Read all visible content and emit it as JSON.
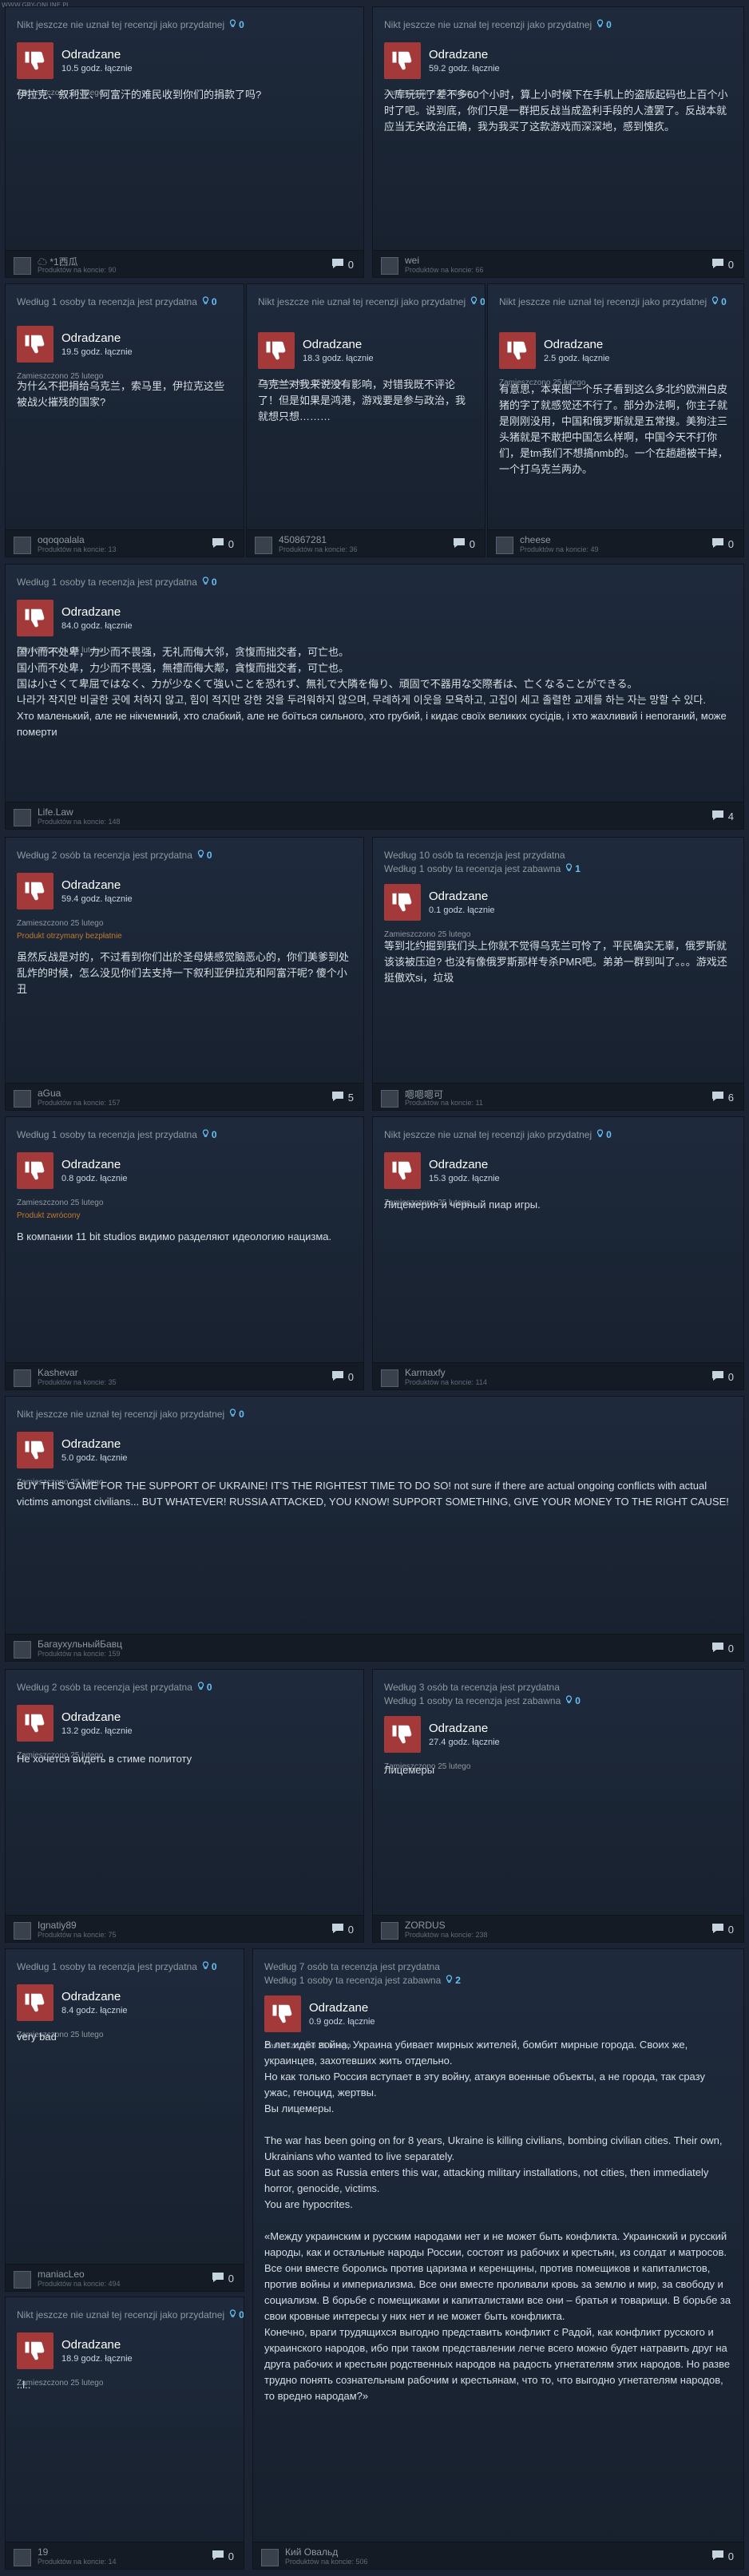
{
  "watermark": "WWW.GRY-ONLINE.PL",
  "theme": {
    "thumb_bg": "#a33939",
    "bulb": "#66c0f4",
    "note_orange": "#c47a2c"
  },
  "icons": {
    "thumb": "thumbs-down-icon",
    "bulb": "lightbulb-icon",
    "comment": "comment-icon"
  },
  "reviews": [
    {
      "h1": "Nikt jeszcze nie uznał tej recenzji jako przydatnej",
      "h1c": "0",
      "h2": "",
      "h2c": "",
      "verdict": "Odradzane",
      "hours": "10.5 godz. łącznie",
      "posted": "Zamieszczono 25 lutego",
      "note": "",
      "body": "伊拉克、叙利亚、阿富汗的难民收到你们的捐款了吗?",
      "user": "☁ *1西瓜",
      "upost": "Produktów na koncie: 90",
      "comments": "0"
    },
    {
      "h1": "Nikt jeszcze nie uznał tej recenzji jako przydatnej",
      "h1c": "0",
      "h2": "",
      "h2c": "",
      "verdict": "Odradzane",
      "hours": "59.2 godz. łącznie",
      "posted": "Zamieszczono 25 lutego",
      "note": "",
      "body": "入库玩玩了差不多60个小时，算上小时候下在手机上的盗版起码也上百个小时了吧。说到底，你们只是一群把反战当成盈利手段的人渣罢了。反战本就应当无关政治正确，我为我买了这款游戏而深深地，感到愧疚。",
      "user": "wei",
      "upost": "Produktów na koncie: 66",
      "comments": "0"
    },
    {
      "h1": "Według 1 osoby ta recenzja jest przydatna",
      "h1c": "0",
      "h2": "",
      "h2c": "",
      "verdict": "Odradzane",
      "hours": "19.5 godz. łącznie",
      "posted": "Zamieszczono 25 lutego",
      "note": "",
      "body": "为什么不把捐给乌克兰，索马里，伊拉克这些被战火摧残的国家?",
      "user": "oqoqoalala",
      "upost": "Produktów na koncie: 13",
      "comments": "0"
    },
    {
      "h1": "Nikt jeszcze nie uznał tej recenzji jako przydatnej",
      "h1c": "0",
      "h2": "",
      "h2c": "",
      "verdict": "Odradzane",
      "hours": "18.3 godz. łącznie",
      "posted": "Zamieszczono 25 lutego",
      "note": "",
      "body": "乌克兰对我来说没有影响，对错我既不评论了！但是如果是鸿港，游戏要是参与政治，我就想只想………",
      "user": "450867281",
      "upost": "Produktów na koncie: 36",
      "comments": "0"
    },
    {
      "h1": "Nikt jeszcze nie uznał tej recenzji jako przydatnej",
      "h1c": "0",
      "h2": "",
      "h2c": "",
      "verdict": "Odradzane",
      "hours": "2.5 godz. łącznie",
      "posted": "Zamieszczono 25 lutego",
      "note": "",
      "body": "有意思，本来图一个乐子看到这么多北约欧洲白皮猪的字了就感觉还不行了。部分办法啊，你主子就是刚刚没用，中国和俄罗斯就是五常搜。美狗注三头猪就是不敢把中国怎么样啊，中国今天不打你们，是tm我们不想搞nmb的。一个在趟趟被干掉，一个打乌克兰两办。",
      "user": "cheese",
      "upost": "Produktów na koncie: 49",
      "comments": "0"
    },
    {
      "h1": "Według 1 osoby ta recenzja jest przydatna",
      "h1c": "0",
      "h2": "",
      "h2c": "",
      "verdict": "Odradzane",
      "hours": "84.0 godz. łącznie",
      "posted": "Zamieszczono 25 lutego",
      "note": "",
      "body": "国小而不处卑，力少而不畏强，无礼而侮大邻，贪愎而拙交者，可亡也。\n国小而不处卑，力少而不畏强，無禮而侮大鄰，貪愎而拙交者，可亡也。\n国は小さくて卑屈ではなく、力が少なくて強いことを恐れず、無礼で大隣を侮り、頑固で不器用な交際者は、亡くなることができる。\n나라가 작지만 비굴한 곳에 처하지 않고, 힘이 적지만 강한 것을 두려워하지 않으며, 무례하게 이웃을 모욕하고, 고집이 세고 졸렬한 교제를 하는 자는 망할 수 있다.\nХто маленький, але не нікчемний, хто слабкий, але не боїться сильного, хто грубий, і кидає своїх великих сусідів, і хто жахливий і непоганий, може померти",
      "user": "Life.Law",
      "upost": "Produktów na koncie: 148",
      "comments": "4"
    },
    {
      "h1": "Według 2 osób ta recenzja jest przydatna",
      "h1c": "0",
      "h2": "",
      "h2c": "",
      "verdict": "Odradzane",
      "hours": "59.4 godz. łącznie",
      "posted": "Zamieszczono 25 lutego",
      "note": "Produkt otrzymany bezpłatnie",
      "body": "虽然反战是对的，不过看到你们出於圣母婊感觉脑恶心的，你们美爹到处乱炸的时候，怎么没见你们去支持一下叙利亚伊拉克和阿富汗呢? 傻个小丑",
      "user": "aGua",
      "upost": "Produktów na koncie: 157",
      "comments": "5"
    },
    {
      "h1": "Według 10 osób ta recenzja jest przydatna",
      "h1c": "",
      "h2": "Według 1 osoby ta recenzja jest zabawna",
      "h2c": "1",
      "verdict": "Odradzane",
      "hours": "0.1 godz. łącznie",
      "posted": "Zamieszczono 25 lutego",
      "note": "",
      "body": "等到北约掘到我们头上你就不觉得乌克兰可怜了，平民确实无辜，俄罗斯就该该被压迫? 也没有像俄罗斯那样专杀PMR吧。弟弟一群到叫了。。。游戏还挺傲欢si，垃圾",
      "user": "嗯嗯嗯可",
      "upost": "Produktów na koncie: 11",
      "comments": "6"
    },
    {
      "h1": "Według 1 osoby ta recenzja jest przydatna",
      "h1c": "0",
      "h2": "",
      "h2c": "",
      "verdict": "Odradzane",
      "hours": "0.8 godz. łącznie",
      "posted": "Zamieszczono 25 lutego",
      "note": "Produkt zwrócony",
      "body": "В компании 11 bit studios видимо разделяют идеологию нацизма.",
      "user": "Kashevar",
      "upost": "Produktów na koncie: 35",
      "comments": "0"
    },
    {
      "h1": "Nikt jeszcze nie uznał tej recenzji jako przydatnej",
      "h1c": "0",
      "h2": "",
      "h2c": "",
      "verdict": "Odradzane",
      "hours": "15.3 godz. łącznie",
      "posted": "Zamieszczono 25 lutego",
      "note": "",
      "body": "Лицемерия и черный пиар игры.",
      "user": "Karmaxfy",
      "upost": "Produktów na koncie: 114",
      "comments": "0"
    },
    {
      "h1": "Nikt jeszcze nie uznał tej recenzji jako przydatnej",
      "h1c": "0",
      "h2": "",
      "h2c": "",
      "verdict": "Odradzane",
      "hours": "5.0 godz. łącznie",
      "posted": "Zamieszczono 25 lutego",
      "note": "",
      "body": "BUY THIS GAME FOR THE SUPPORT OF UKRAINE! IT'S THE RIGHTEST TIME TO DO SO! not sure if there are actual ongoing conflicts with actual victims amongst civilians... BUT WHATEVER! RUSSIA ATTACKED, YOU KNOW! SUPPORT SOMETHING, GIVE YOUR MONEY TO THE RIGHT CAUSE!",
      "user": "БагаухульныйБавц",
      "upost": "Produktów na koncie: 159",
      "comments": "0"
    },
    {
      "h1": "Według 2 osób ta recenzja jest przydatna",
      "h1c": "0",
      "h2": "",
      "h2c": "",
      "verdict": "Odradzane",
      "hours": "13.2 godz. łącznie",
      "posted": "Zamieszczono 25 lutego",
      "note": "",
      "body": "Не хочется видеть в стиме политоту",
      "user": "Ignatiy89",
      "upost": "Produktów na koncie: 75",
      "comments": "0"
    },
    {
      "h1": "Według 3 osób ta recenzja jest przydatna",
      "h1c": "",
      "h2": "Według 1 osoby ta recenzja jest zabawna",
      "h2c": "0",
      "verdict": "Odradzane",
      "hours": "27.4 godz. łącznie",
      "posted": "Zamieszczono 25 lutego",
      "note": "",
      "body": "Лицемеры",
      "user": "ZORDUS",
      "upost": "Produktów na koncie: 238",
      "comments": "0"
    },
    {
      "h1": "Według 1 osoby ta recenzja jest przydatna",
      "h1c": "0",
      "h2": "",
      "h2c": "",
      "verdict": "Odradzane",
      "hours": "8.4 godz. łącznie",
      "posted": "Zamieszczono 25 lutego",
      "note": "",
      "body": "very bad",
      "user": "maniacLeo",
      "upost": "Produktów na koncie: 494",
      "comments": "0"
    },
    {
      "h1": "Według 7 osób ta recenzja jest przydatna",
      "h1c": "",
      "h2": "Według 1 osoby ta recenzja jest zabawna",
      "h2c": "2",
      "verdict": "Odradzane",
      "hours": "0.9 godz. łącznie",
      "posted": "Zamieszczono 25 lutego",
      "note": "",
      "body": "В лет идёт война, Украина убивает мирных жителей, бомбит мирные города. Своих же, украинцев, захотевших жить отдельно.\nНо как только Россия вступает в эту войну, атакуя военные объекты, а не города, так сразу ужас, геноцид, жертвы.\nВы лицемеры.\n\nThe war has been going on for 8 years, Ukraine is killing civilians, bombing civilian cities. Their own, Ukrainians who wanted to live separately.\nBut as soon as Russia enters this war, attacking military installations, not cities, then immediately horror, genocide, victims.\nYou are hypocrites.\n\n«Между украинским и русским народами нет и не может быть конфликта. Украинский и русский народы, как и остальные народы России, состоят из рабочих и крестьян, из солдат и матросов. Все они вместе боролись против царизма и керенщины, против помещиков и капиталистов, против войны и империализма. Все они вместе проливали кровь за землю и мир, за свободу и социализм. В борьбе с помещиками и капиталистами все они – братья и товарищи. В борьбе за свои кровные интересы у них нет и не может быть конфликта.\nКонечно, враги трудящихся выгодно представить конфликт с Радой, как конфликт русского и украинского народов, ибо при таком представлении легче всего можно будет натравить друг на друга рабочих и крестьян родственных народов на радость угнетателям этих народов. Но разве трудно понять сознательным рабочим и крестьянам, что то, что выгодно угнетателям народов, то вредно народам?»",
      "user": "Кий Овальд",
      "upost": "Produktów na koncie: 506",
      "comments": "0"
    },
    {
      "h1": "Nikt jeszcze nie uznał tej recenzji jako przydatnej",
      "h1c": "0",
      "h2": "",
      "h2c": "",
      "verdict": "Odradzane",
      "hours": "18.9 godz. łącznie",
      "posted": "Zamieszczono 25 lutego",
      "note": "",
      "body": "..l..",
      "user": "19",
      "upost": "Produktów na koncie: 14",
      "comments": "0"
    }
  ]
}
